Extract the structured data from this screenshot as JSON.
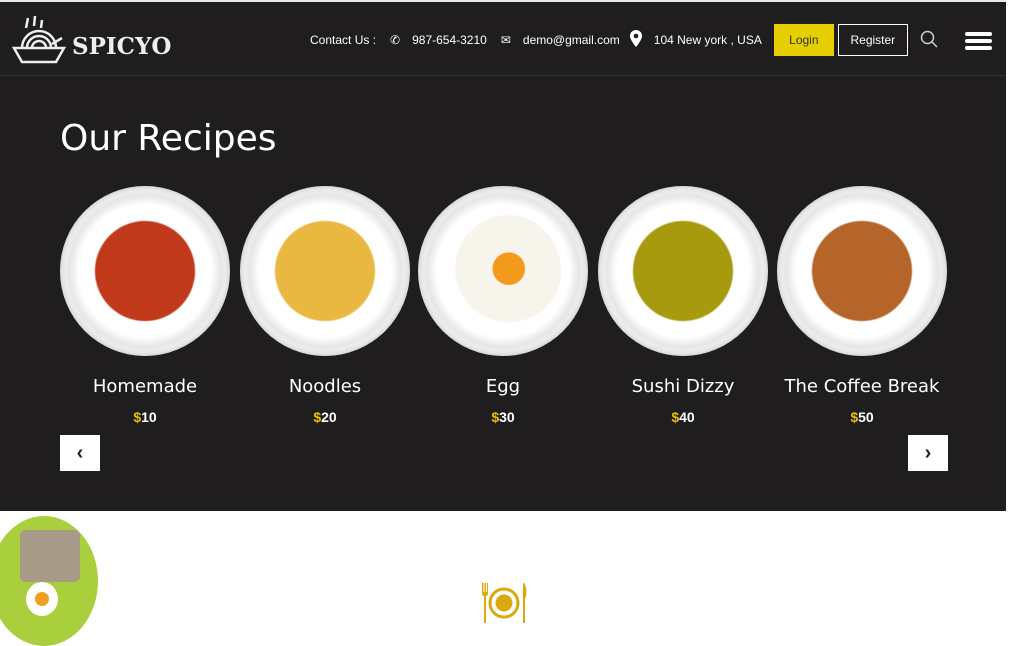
{
  "header": {
    "brand": "SPICYO",
    "contact_label": "Contact Us :",
    "phone": "987-654-3210",
    "email": "demo@gmail.com",
    "address": "104 New york , USA",
    "login": "Login",
    "register": "Register"
  },
  "recipes": {
    "title": "Our Recipes",
    "currency": "$",
    "items": [
      {
        "name": "Homemade",
        "price": "10",
        "color": "#c0391b"
      },
      {
        "name": "Noodles",
        "price": "20",
        "color": "#e8b840"
      },
      {
        "name": "Egg",
        "price": "30",
        "color": "#f5f2ea"
      },
      {
        "name": "Sushi Dizzy",
        "price": "40",
        "color": "#a79a0f"
      },
      {
        "name": "The Coffee Break",
        "price": "50",
        "color": "#b5652a"
      }
    ]
  },
  "colors": {
    "accent": "#e5cf00",
    "dark": "#1f1d1e"
  }
}
